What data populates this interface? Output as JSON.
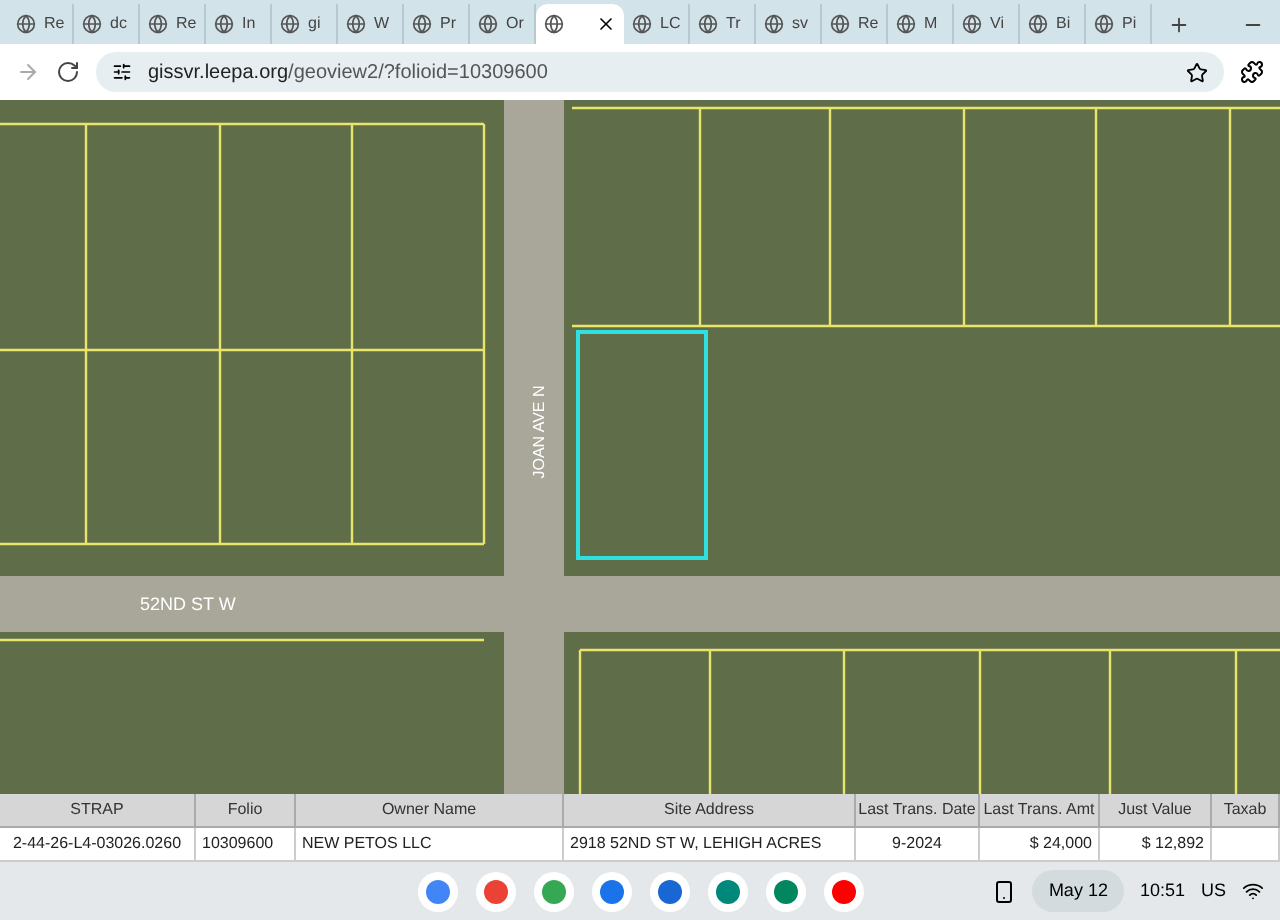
{
  "tabs": [
    {
      "label": "Re",
      "selected": false
    },
    {
      "label": "dc",
      "selected": false
    },
    {
      "label": "Re",
      "selected": false
    },
    {
      "label": "In",
      "selected": false
    },
    {
      "label": "gi",
      "selected": false
    },
    {
      "label": "W",
      "selected": false
    },
    {
      "label": "Pr",
      "selected": false
    },
    {
      "label": "Or",
      "selected": false
    },
    {
      "selected": true
    },
    {
      "label": "LC",
      "selected": false
    },
    {
      "label": "Tr",
      "selected": false
    },
    {
      "label": "sv",
      "selected": false
    },
    {
      "label": "Re",
      "selected": false
    },
    {
      "label": "M",
      "selected": false
    },
    {
      "label": "Vi",
      "selected": false
    },
    {
      "label": "Bi",
      "selected": false
    },
    {
      "label": "Pi",
      "selected": false
    }
  ],
  "address_bar": {
    "host": "gissvr.leepa.org",
    "path": "/geoview2/?folioid=10309600"
  },
  "map": {
    "street_labels": [
      {
        "text": "JOAN AVE N",
        "kind": "vertical"
      },
      {
        "text": "52ND ST W",
        "kind": "horizontal"
      }
    ]
  },
  "table": {
    "columns": [
      "STRAP",
      "Folio",
      "Owner Name",
      "Site Address",
      "Last Trans. Date",
      "Last Trans. Amt",
      "Just Value",
      "Taxab"
    ],
    "rows": [
      [
        "2-44-26-L4-03026.0260",
        "10309600",
        "NEW PETOS LLC",
        "2918 52ND ST W, LEHIGH ACRES",
        "9-2024",
        "$ 24,000",
        "$ 12,892"
      ]
    ]
  },
  "taskbar": {
    "date": "May 12",
    "time": "10:51",
    "locale": "US"
  }
}
